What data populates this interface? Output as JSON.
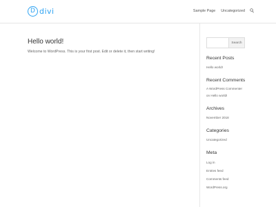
{
  "header": {
    "logo_letter": "D",
    "logo_text": "divi",
    "nav": [
      "Sample Page",
      "Uncategorized"
    ]
  },
  "post": {
    "title": "Hello world!",
    "body": "Welcome to WordPress. This is your first post. Edit or delete it, then start writing!"
  },
  "sidebar": {
    "search_placeholder": "",
    "search_button": "Search",
    "recent_posts": {
      "title": "Recent Posts",
      "items": [
        "Hello world!"
      ]
    },
    "recent_comments": {
      "title": "Recent Comments",
      "line1": "A WordPress Commenter",
      "line2": "on Hello world!"
    },
    "archives": {
      "title": "Archives",
      "items": [
        "November 2018"
      ]
    },
    "categories": {
      "title": "Categories",
      "items": [
        "Uncategorized"
      ]
    },
    "meta": {
      "title": "Meta",
      "items": [
        "Log in",
        "Entries feed",
        "Comments feed",
        "WordPress.org"
      ]
    }
  },
  "colors": {
    "accent": "#2ea3f2",
    "heading": "#333333",
    "text": "#666666",
    "border": "#dddddd"
  },
  "icons": {
    "nav_search": "search-icon"
  }
}
